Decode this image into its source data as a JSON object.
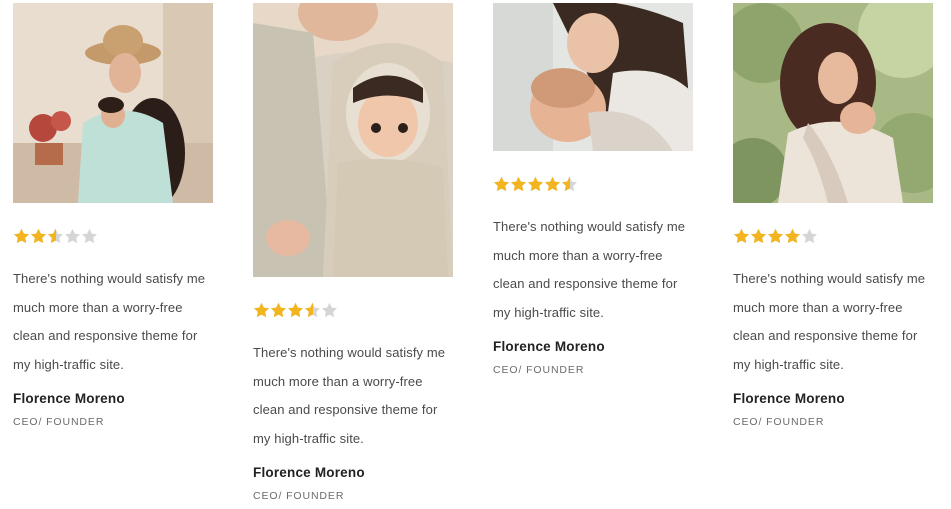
{
  "colors": {
    "star_filled": "#f3b51f",
    "star_empty": "#d5d5d5",
    "text": "#4a4a4a",
    "name": "#222222",
    "role": "#6b6b6b"
  },
  "testimonials": [
    {
      "image_icon": "photo-mother-in-hat-with-baby-carrier",
      "rating": 2.5,
      "rating_max": 5,
      "quote": "There's nothing would satisfy me much more than a worry-free clean and responsive theme for my high-traffic site.",
      "name": "Florence Moreno",
      "role": "CEO/ FOUNDER"
    },
    {
      "image_icon": "photo-baby-in-hooded-carrier",
      "rating": 3.5,
      "rating_max": 5,
      "quote": "There's nothing would satisfy me much more than a worry-free clean and responsive theme for my high-traffic site.",
      "name": "Florence Moreno",
      "role": "CEO/ FOUNDER"
    },
    {
      "image_icon": "photo-mother-kissing-baby",
      "rating": 4.5,
      "rating_max": 5,
      "quote": "There's nothing would satisfy me much more than a worry-free clean and responsive theme for my high-traffic site.",
      "name": "Florence Moreno",
      "role": "CEO/ FOUNDER"
    },
    {
      "image_icon": "photo-mother-with-baby-wrap-outdoors",
      "rating": 4,
      "rating_max": 5,
      "quote": "There's nothing would satisfy me much more than a worry-free clean and responsive theme for my high-traffic site.",
      "name": "Florence Moreno",
      "role": "CEO/ FOUNDER"
    }
  ]
}
